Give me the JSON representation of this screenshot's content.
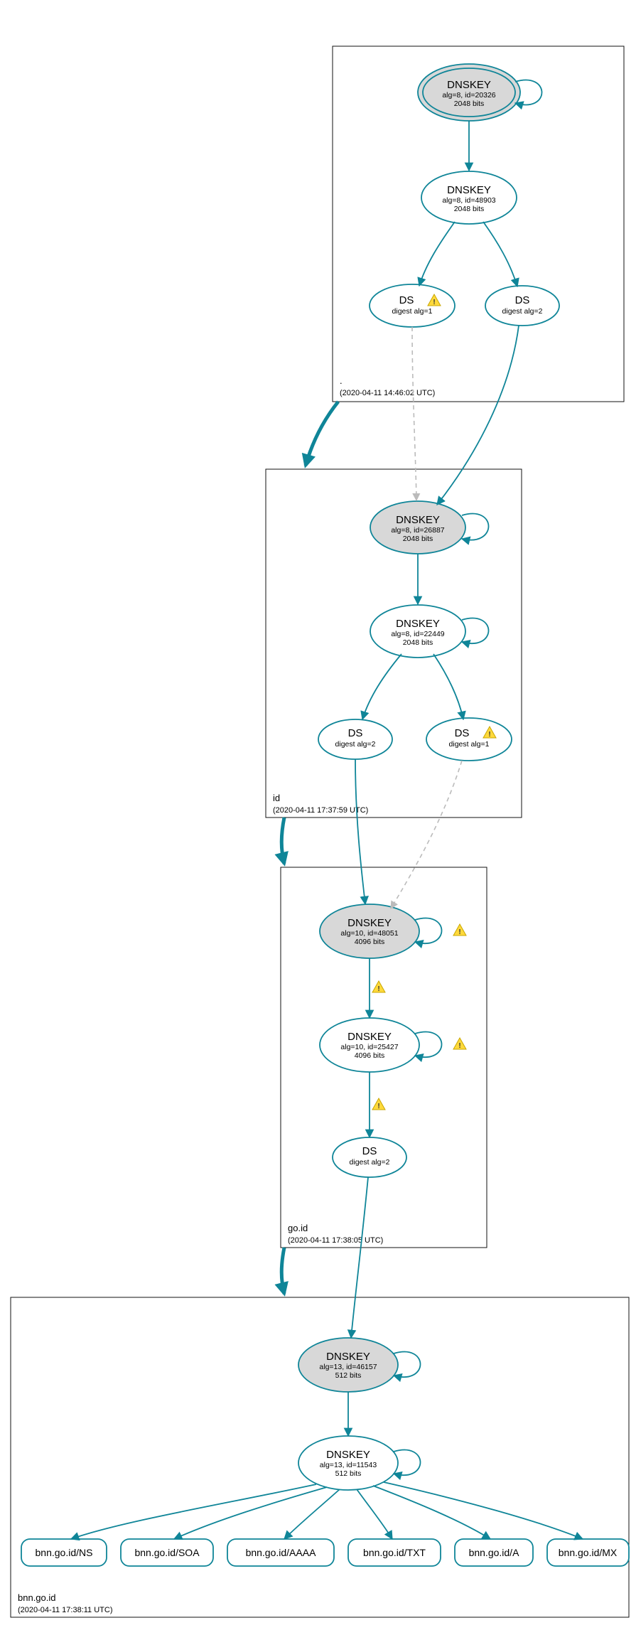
{
  "zones": {
    "root": {
      "name": ".",
      "timestamp": "(2020-04-11 14:46:02 UTC)"
    },
    "id": {
      "name": "id",
      "timestamp": "(2020-04-11 17:37:59 UTC)"
    },
    "goid": {
      "name": "go.id",
      "timestamp": "(2020-04-11 17:38:05 UTC)"
    },
    "bnn": {
      "name": "bnn.go.id",
      "timestamp": "(2020-04-11 17:38:11 UTC)"
    }
  },
  "nodes": {
    "root_ksk": {
      "title": "DNSKEY",
      "line1": "alg=8, id=20326",
      "line2": "2048 bits"
    },
    "root_zsk": {
      "title": "DNSKEY",
      "line1": "alg=8, id=48903",
      "line2": "2048 bits"
    },
    "root_ds1": {
      "title": "DS",
      "line1": "digest alg=1"
    },
    "root_ds2": {
      "title": "DS",
      "line1": "digest alg=2"
    },
    "id_ksk": {
      "title": "DNSKEY",
      "line1": "alg=8, id=26887",
      "line2": "2048 bits"
    },
    "id_zsk": {
      "title": "DNSKEY",
      "line1": "alg=8, id=22449",
      "line2": "2048 bits"
    },
    "id_ds2": {
      "title": "DS",
      "line1": "digest alg=2"
    },
    "id_ds1": {
      "title": "DS",
      "line1": "digest alg=1"
    },
    "goid_ksk": {
      "title": "DNSKEY",
      "line1": "alg=10, id=48051",
      "line2": "4096 bits"
    },
    "goid_zsk": {
      "title": "DNSKEY",
      "line1": "alg=10, id=25427",
      "line2": "4096 bits"
    },
    "goid_ds": {
      "title": "DS",
      "line1": "digest alg=2"
    },
    "bnn_ksk": {
      "title": "DNSKEY",
      "line1": "alg=13, id=46157",
      "line2": "512 bits"
    },
    "bnn_zsk": {
      "title": "DNSKEY",
      "line1": "alg=13, id=11543",
      "line2": "512 bits"
    }
  },
  "rrsets": {
    "ns": "bnn.go.id/NS",
    "soa": "bnn.go.id/SOA",
    "aaaa": "bnn.go.id/AAAA",
    "txt": "bnn.go.id/TXT",
    "a": "bnn.go.id/A",
    "mx": "bnn.go.id/MX"
  }
}
